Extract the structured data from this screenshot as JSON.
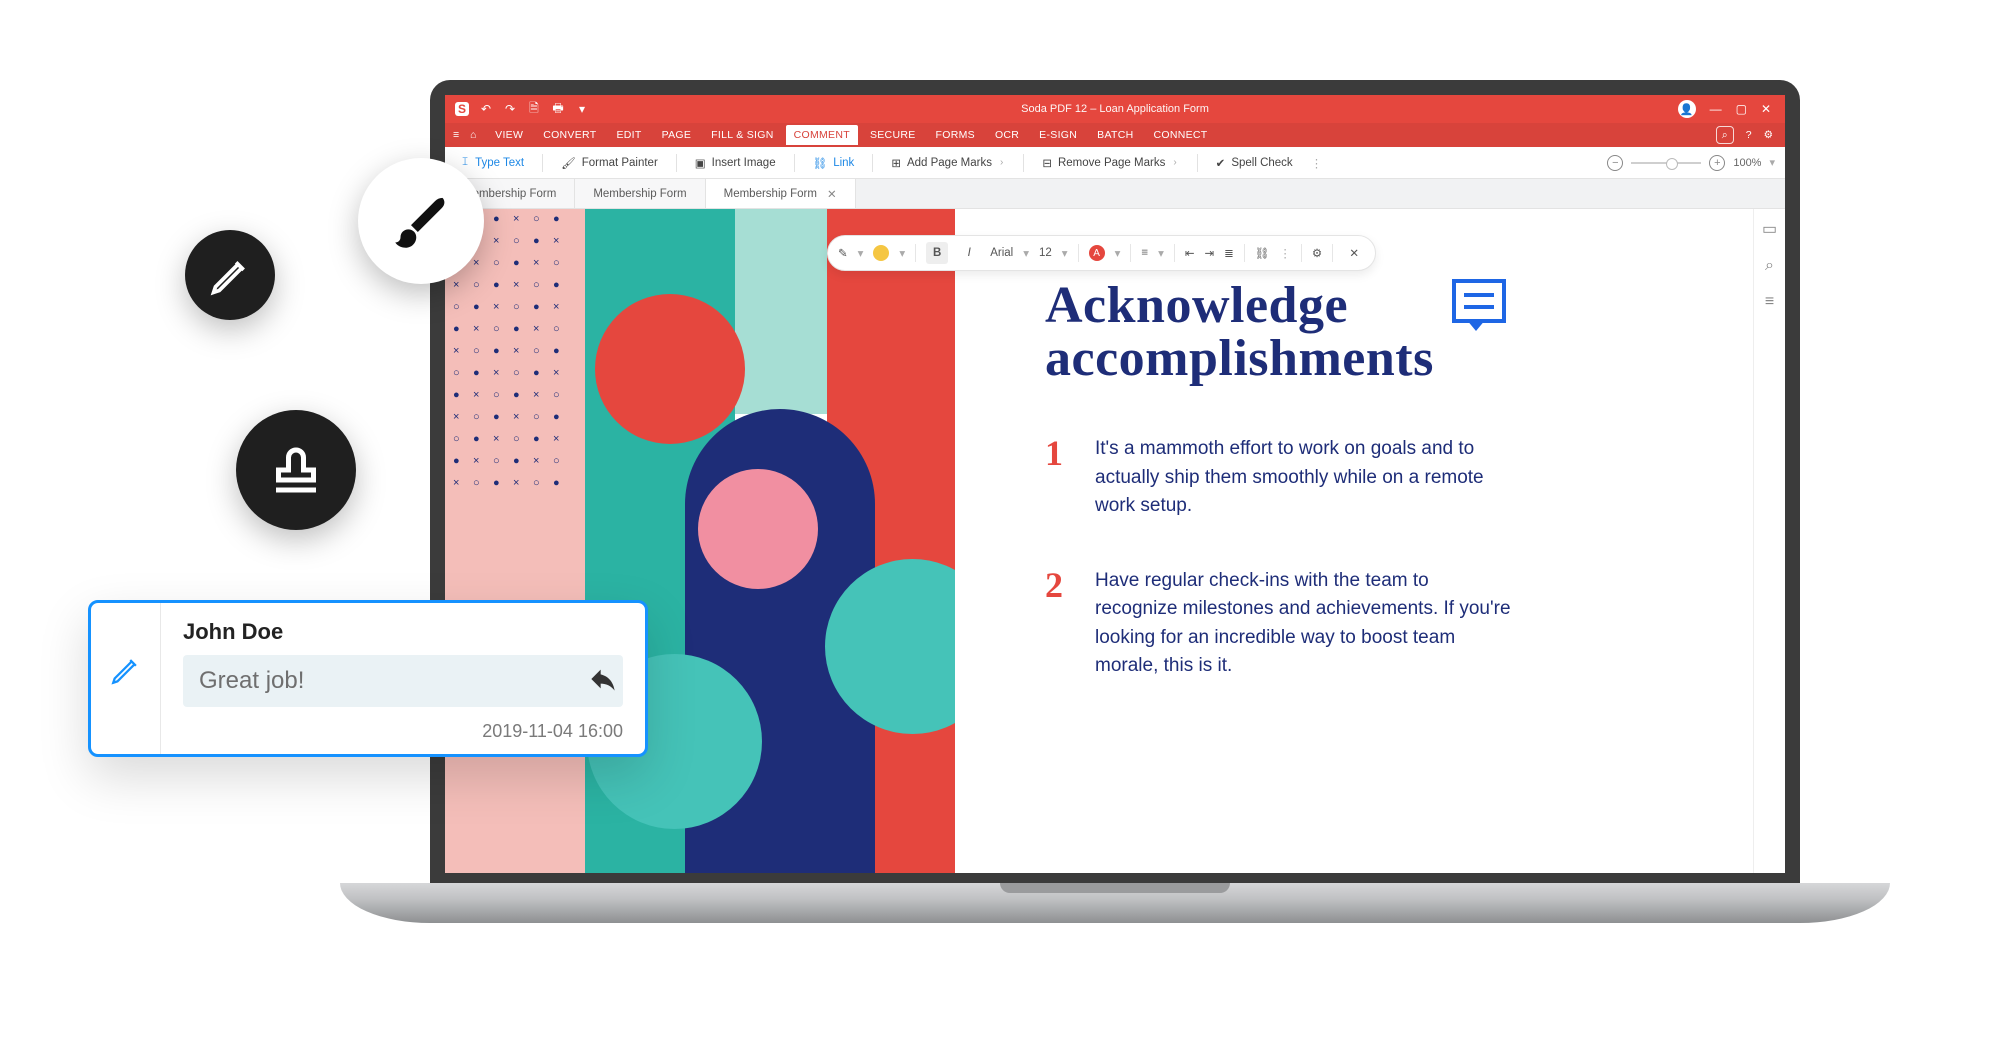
{
  "window": {
    "app_logo_letter": "S",
    "title_center": "Soda PDF 12  –  Loan Application Form",
    "qat": {
      "undo": "↶",
      "redo": "↷",
      "save": "🗎",
      "print": "🖶",
      "more": "▾"
    },
    "controls": {
      "user": "👤",
      "minimize": "—",
      "maximize": "▢",
      "close": "✕"
    }
  },
  "menu": {
    "items": [
      "VIEW",
      "CONVERT",
      "EDIT",
      "PAGE",
      "FILL & SIGN",
      "COMMENT",
      "SECURE",
      "FORMS",
      "OCR",
      "E-SIGN",
      "BATCH",
      "CONNECT"
    ],
    "active_index": 5,
    "search_icon": "⌕",
    "help_icon": "?",
    "gear_icon": "⚙"
  },
  "ribbon": {
    "type_text": "Type Text",
    "format_painter": "Format Painter",
    "insert_image": "Insert Image",
    "link": "Link",
    "add_page_marks": "Add Page Marks",
    "remove_page_marks": "Remove Page Marks",
    "spell_check": "Spell Check",
    "zoom_value": "100%"
  },
  "tabs": {
    "items": [
      "Membership Form",
      "Membership Form",
      "Membership Form"
    ],
    "active_index": 2
  },
  "format_toolbar": {
    "font": "Arial",
    "size": "12",
    "color_letter": "A",
    "bold": "B",
    "italic": "I"
  },
  "sidestrip": {
    "page_thumb": "▭",
    "search": "⌕",
    "layers": "≡"
  },
  "document": {
    "heading_line1": "Acknowledge",
    "heading_line2": "accomplishments",
    "items": [
      {
        "num": "1",
        "text": "It's a mammoth effort to work on goals and to actually ship them smoothly while on a remote work setup."
      },
      {
        "num": "2",
        "text": "Have regular check-ins with the team to recognize milestones and achievements. If you're looking for an incredible way to boost team morale, this is it."
      }
    ]
  },
  "comment_popup": {
    "author": "John Doe",
    "text": "Great job!",
    "timestamp": "2019-11-04  16:00"
  },
  "fabs": {
    "brush": "brush",
    "pencil": "pencil",
    "stamp": "stamp"
  }
}
